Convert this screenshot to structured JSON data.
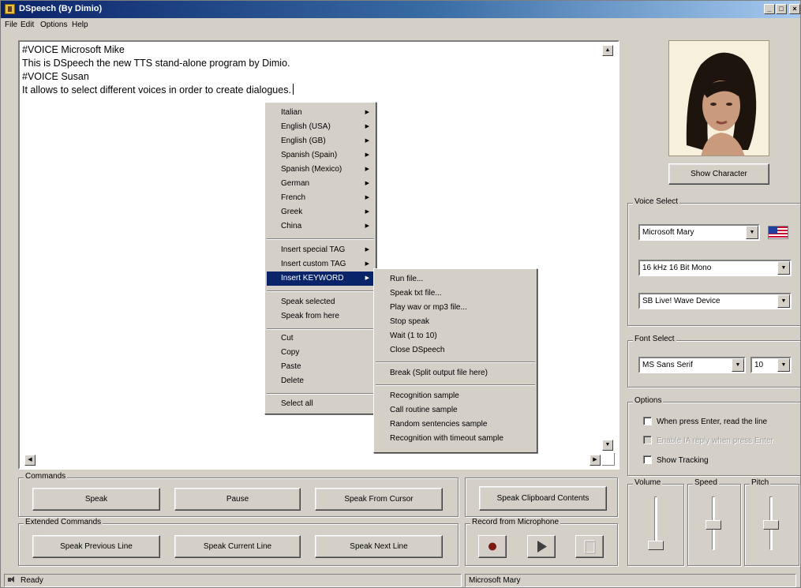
{
  "window": {
    "title": "DSpeech (By Dimio)"
  },
  "menubar": [
    "File",
    "Edit",
    "Options",
    "Help"
  ],
  "editor": {
    "lines": [
      "#VOICE Microsoft Mike",
      "This is DSpeech the new TTS stand-alone program by Dimio.",
      "#VOICE Susan",
      "It allows to select different voices in order to create dialogues."
    ]
  },
  "context_menu": {
    "languages": [
      "Italian",
      "English (USA)",
      "English (GB)",
      "Spanish (Spain)",
      "Spanish (Mexico)",
      "German",
      "French",
      "Greek",
      "China"
    ],
    "insert": [
      "Insert special TAG",
      "Insert custom TAG",
      "Insert KEYWORD"
    ],
    "speak": [
      "Speak selected",
      "Speak from here"
    ],
    "edit": [
      "Cut",
      "Copy",
      "Paste",
      "Delete"
    ],
    "select_all": "Select all"
  },
  "submenu": {
    "keywords": [
      "Run file...",
      "Speak txt file...",
      "Play wav or mp3 file...",
      "Stop speak",
      "Wait (1 to 10)",
      "Close DSpeech"
    ],
    "break": "Break (Split output file here)",
    "samples": [
      "Recognition sample",
      "Call routine sample",
      "Random sentencies sample",
      "Recognition with timeout sample"
    ]
  },
  "right_panel": {
    "show_character": "Show Character",
    "voice_select": {
      "label": "Voice Select",
      "voice": "Microsoft Mary",
      "format": "16 kHz 16 Bit Mono",
      "device": "SB Live! Wave Device"
    },
    "font_select": {
      "label": "Font Select",
      "font": "MS Sans Serif",
      "size": "10"
    },
    "options": {
      "label": "Options",
      "enter_read": "When press Enter, read the line",
      "enable_reply": "Enable IA reply when press Enter",
      "show_tracking": "Show Tracking"
    },
    "sliders": {
      "volume": "Volume",
      "speed": "Speed",
      "pitch": "Pitch"
    }
  },
  "commands": {
    "label": "Commands",
    "speak": "Speak",
    "pause": "Pause",
    "speak_from_cursor": "Speak From Cursor",
    "speak_clipboard": "Speak Clipboard Contents"
  },
  "extended_commands": {
    "label": "Extended Commands",
    "previous": "Speak Previous Line",
    "current": "Speak Current Line",
    "next": "Speak Next Line"
  },
  "record": {
    "label": "Record from Microphone"
  },
  "status": {
    "text": "Ready",
    "voice": "Microsoft Mary"
  },
  "colors": {
    "title_start": "#0a246a",
    "highlight": "#0a246a",
    "face": "#d4d0c8"
  }
}
